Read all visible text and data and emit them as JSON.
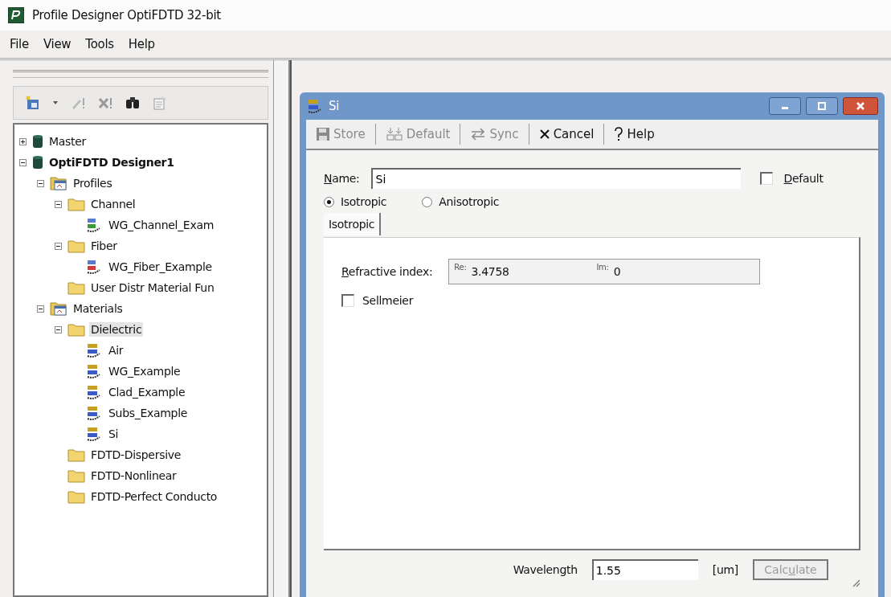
{
  "window": {
    "title": "Profile Designer OptiFDTD 32-bit"
  },
  "menu": [
    "File",
    "View",
    "Tools",
    "Help"
  ],
  "tree": [
    {
      "label": "Master",
      "kind": "database",
      "expanded": false,
      "active": false,
      "selected": false
    },
    {
      "label": "OptiFDTD Designer1",
      "kind": "database",
      "expanded": true,
      "active": true,
      "selected": false,
      "children": [
        {
          "label": "Profiles",
          "kind": "group",
          "expanded": true,
          "active": false,
          "selected": false,
          "children": [
            {
              "label": "Channel",
              "kind": "folder",
              "expanded": true,
              "active": false,
              "selected": false,
              "children": [
                {
                  "label": "WG_Channel_Exam",
                  "kind": "channel",
                  "active": false,
                  "selected": false
                }
              ]
            },
            {
              "label": "Fiber",
              "kind": "folder",
              "expanded": true,
              "active": false,
              "selected": false,
              "children": [
                {
                  "label": "WG_Fiber_Example",
                  "kind": "fiber",
                  "active": false,
                  "selected": false
                }
              ]
            },
            {
              "label": "User Distr Material Fun",
              "kind": "folder",
              "active": false,
              "selected": false
            }
          ]
        },
        {
          "label": "Materials",
          "kind": "group",
          "expanded": true,
          "active": false,
          "selected": false,
          "children": [
            {
              "label": "Dielectric",
              "kind": "folder",
              "expanded": true,
              "active": false,
              "selected": true,
              "children": [
                {
                  "label": "Air",
                  "kind": "material",
                  "active": false,
                  "selected": false
                },
                {
                  "label": "WG_Example",
                  "kind": "material",
                  "active": false,
                  "selected": false
                },
                {
                  "label": "Clad_Example",
                  "kind": "material",
                  "active": false,
                  "selected": false
                },
                {
                  "label": "Subs_Example",
                  "kind": "material",
                  "active": false,
                  "selected": false
                },
                {
                  "label": "Si",
                  "kind": "material",
                  "active": false,
                  "selected": false
                }
              ]
            },
            {
              "label": "FDTD-Dispersive",
              "kind": "folder",
              "active": false,
              "selected": false
            },
            {
              "label": "FDTD-Nonlinear",
              "kind": "folder",
              "active": false,
              "selected": false
            },
            {
              "label": "FDTD-Perfect Conducto",
              "kind": "folder",
              "active": false,
              "selected": false
            }
          ]
        }
      ]
    }
  ],
  "dialog": {
    "title": "Si",
    "toolbar": [
      {
        "label": "Store",
        "kind": "save",
        "disabled": true
      },
      {
        "label": "Default",
        "kind": "default",
        "disabled": true
      },
      {
        "label": "Sync",
        "kind": "sync",
        "disabled": true
      },
      {
        "label": "Cancel",
        "kind": "cancel",
        "disabled": false
      },
      {
        "label": "Help",
        "kind": "help",
        "disabled": false
      }
    ],
    "name": {
      "label": "Name:",
      "value": "Si"
    },
    "default_checkbox": {
      "label": "Default",
      "checked": false
    },
    "modes": [
      {
        "label": "Isotropic",
        "selected": true
      },
      {
        "label": "Anisotropic",
        "selected": false
      }
    ],
    "tabs": [
      {
        "label": "Isotropic",
        "selected": true
      }
    ],
    "refractive_index": {
      "label": "Refractive index:",
      "re_label": "Re:",
      "re": "3.4758",
      "im_label": "Im:",
      "im": "0"
    },
    "sellmeier": {
      "label": "Sellmeier",
      "checked": false
    },
    "wavelength": {
      "label": "Wavelength",
      "value": "1.55",
      "unit": "[um]"
    },
    "calculate": {
      "label": "Calculate",
      "disabled": true
    }
  }
}
